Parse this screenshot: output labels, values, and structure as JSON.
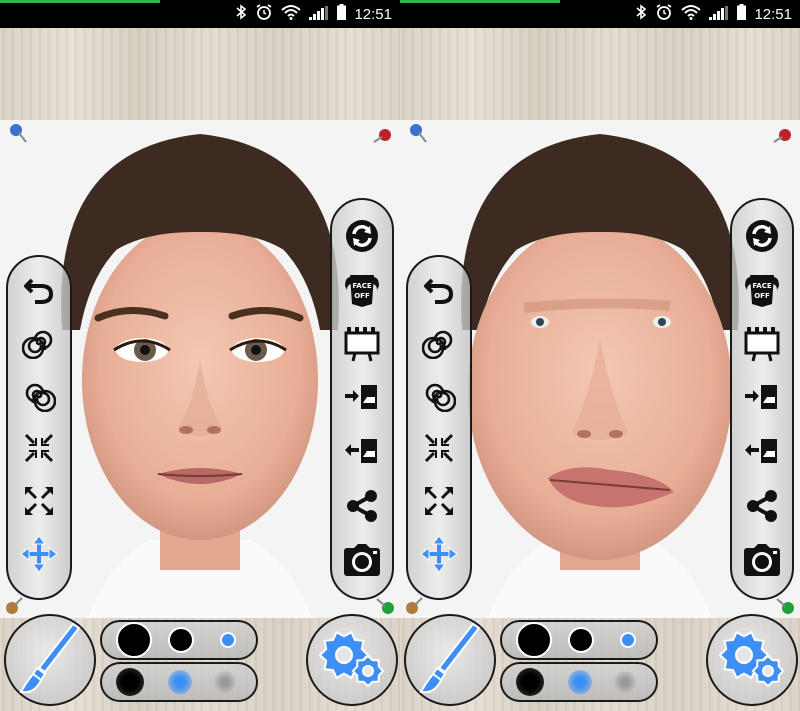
{
  "status_bar": {
    "time": "12:51",
    "icons": [
      "bluetooth-icon",
      "alarm-icon",
      "wifi-icon",
      "signal-icon",
      "battery-icon"
    ]
  },
  "screens": [
    {
      "id": "original",
      "face_state": "normal"
    },
    {
      "id": "warped",
      "face_state": "distorted"
    }
  ],
  "left_tools": [
    "undo-icon",
    "swirl-left-icon",
    "swirl-right-icon",
    "shrink-icon",
    "expand-icon",
    "move-icon"
  ],
  "right_tools": [
    "refresh-icon",
    "face-off-icon",
    "billboard-icon",
    "import-icon",
    "export-icon",
    "share-icon",
    "camera-icon"
  ],
  "face_off_label": "FACE OFF",
  "brush": {
    "sizes": [
      "large",
      "medium",
      "small"
    ],
    "selected_size": "small",
    "hardness": [
      "hard",
      "soft",
      "softest"
    ],
    "selected_hardness": "soft"
  },
  "colors": {
    "accent": "#3d8ff5",
    "status_progress": "#3ab54a",
    "panel_border": "#1a1a1a"
  }
}
